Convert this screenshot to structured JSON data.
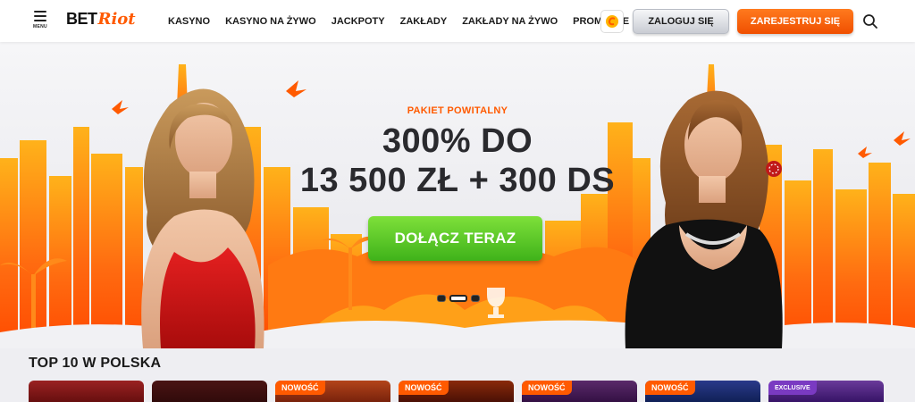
{
  "header": {
    "menu_label": "MENU",
    "logo": {
      "bet": "BET",
      "riot": "Riot"
    },
    "nav": [
      "KASYNO",
      "KASYNO NA ŻYWO",
      "JACKPOTY",
      "ZAKŁADY",
      "ZAKŁADY NA ŻYWO",
      "PROMOCJE"
    ],
    "login_label": "ZALOGUJ SIĘ",
    "register_label": "ZAREJESTRUJ SIĘ"
  },
  "hero": {
    "promo_label": "PAKIET POWITALNY",
    "headline_line1": "300% DO",
    "headline_line2": "13 500 ZŁ + 300 DS",
    "cta_label": "DOŁĄCZ TERAZ",
    "slides_total": 3,
    "active_slide": 2
  },
  "top10": {
    "title": "TOP 10 W POLSKA",
    "tiles": [
      {
        "badge": "",
        "color": "#7a1a1a"
      },
      {
        "badge": "",
        "color": "#3a1010"
      },
      {
        "badge": "NOWOŚĆ",
        "color": "#8a2a10"
      },
      {
        "badge": "NOWOŚĆ",
        "color": "#5a1408"
      },
      {
        "badge": "NOWOŚĆ",
        "color": "#3a1a4a"
      },
      {
        "badge": "NOWOŚĆ",
        "color": "#1a2a6a"
      },
      {
        "badge": "EXCLUSIVE",
        "color": "#4a2a7a"
      }
    ]
  },
  "colors": {
    "accent": "#ff5a00",
    "cta_green": "#4cc22a",
    "headline": "#2a2a2e"
  }
}
